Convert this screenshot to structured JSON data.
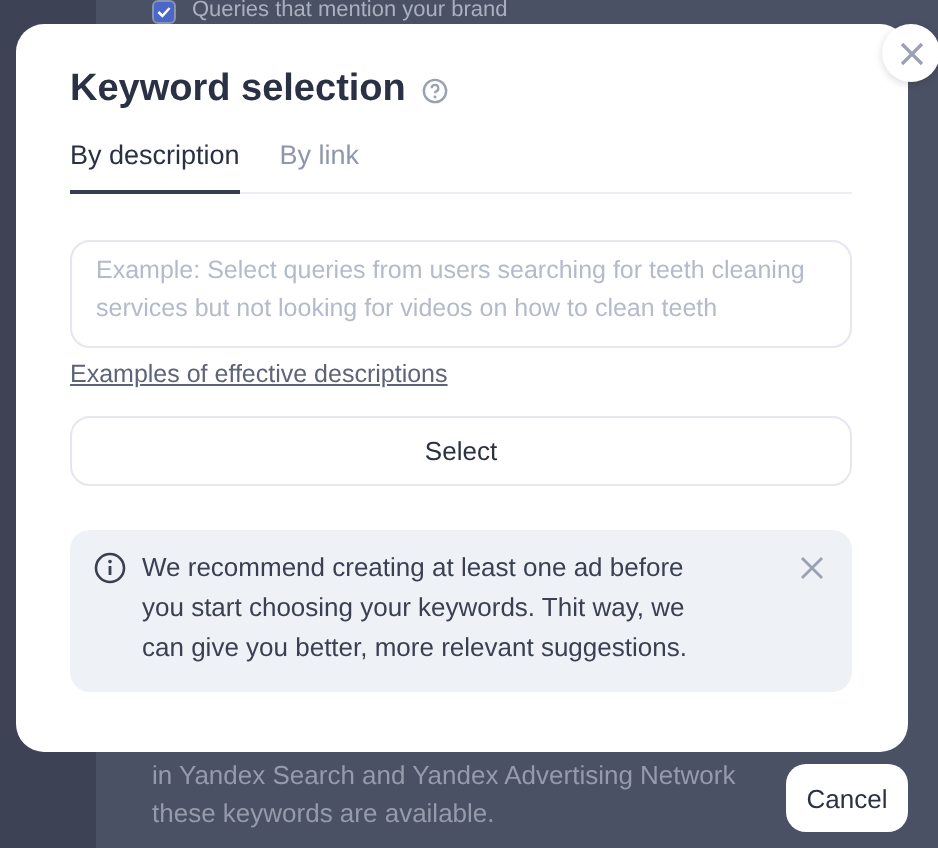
{
  "background": {
    "checkbox": {
      "label": "Queries that mention your brand",
      "checked": true
    },
    "note_lines": [
      "in Yandex Search and Yandex Advertising Network",
      "these keywords are available."
    ]
  },
  "dialog": {
    "title": "Keyword selection",
    "tabs": [
      {
        "label": "By description",
        "selected": true
      },
      {
        "label": "By link",
        "selected": false
      }
    ],
    "description_field": {
      "placeholder": "Example: Select queries from users searching for teeth cleaning services but not looking for videos on how to clean teeth"
    },
    "examples_link": "Examples of effective descriptions",
    "select_button": "Select",
    "alert": {
      "text": "We recommend creating at least one ad before you start choosing your keywords. Thit way, we can give you better, more relevant suggestions."
    }
  },
  "cancel_button": "Cancel"
}
